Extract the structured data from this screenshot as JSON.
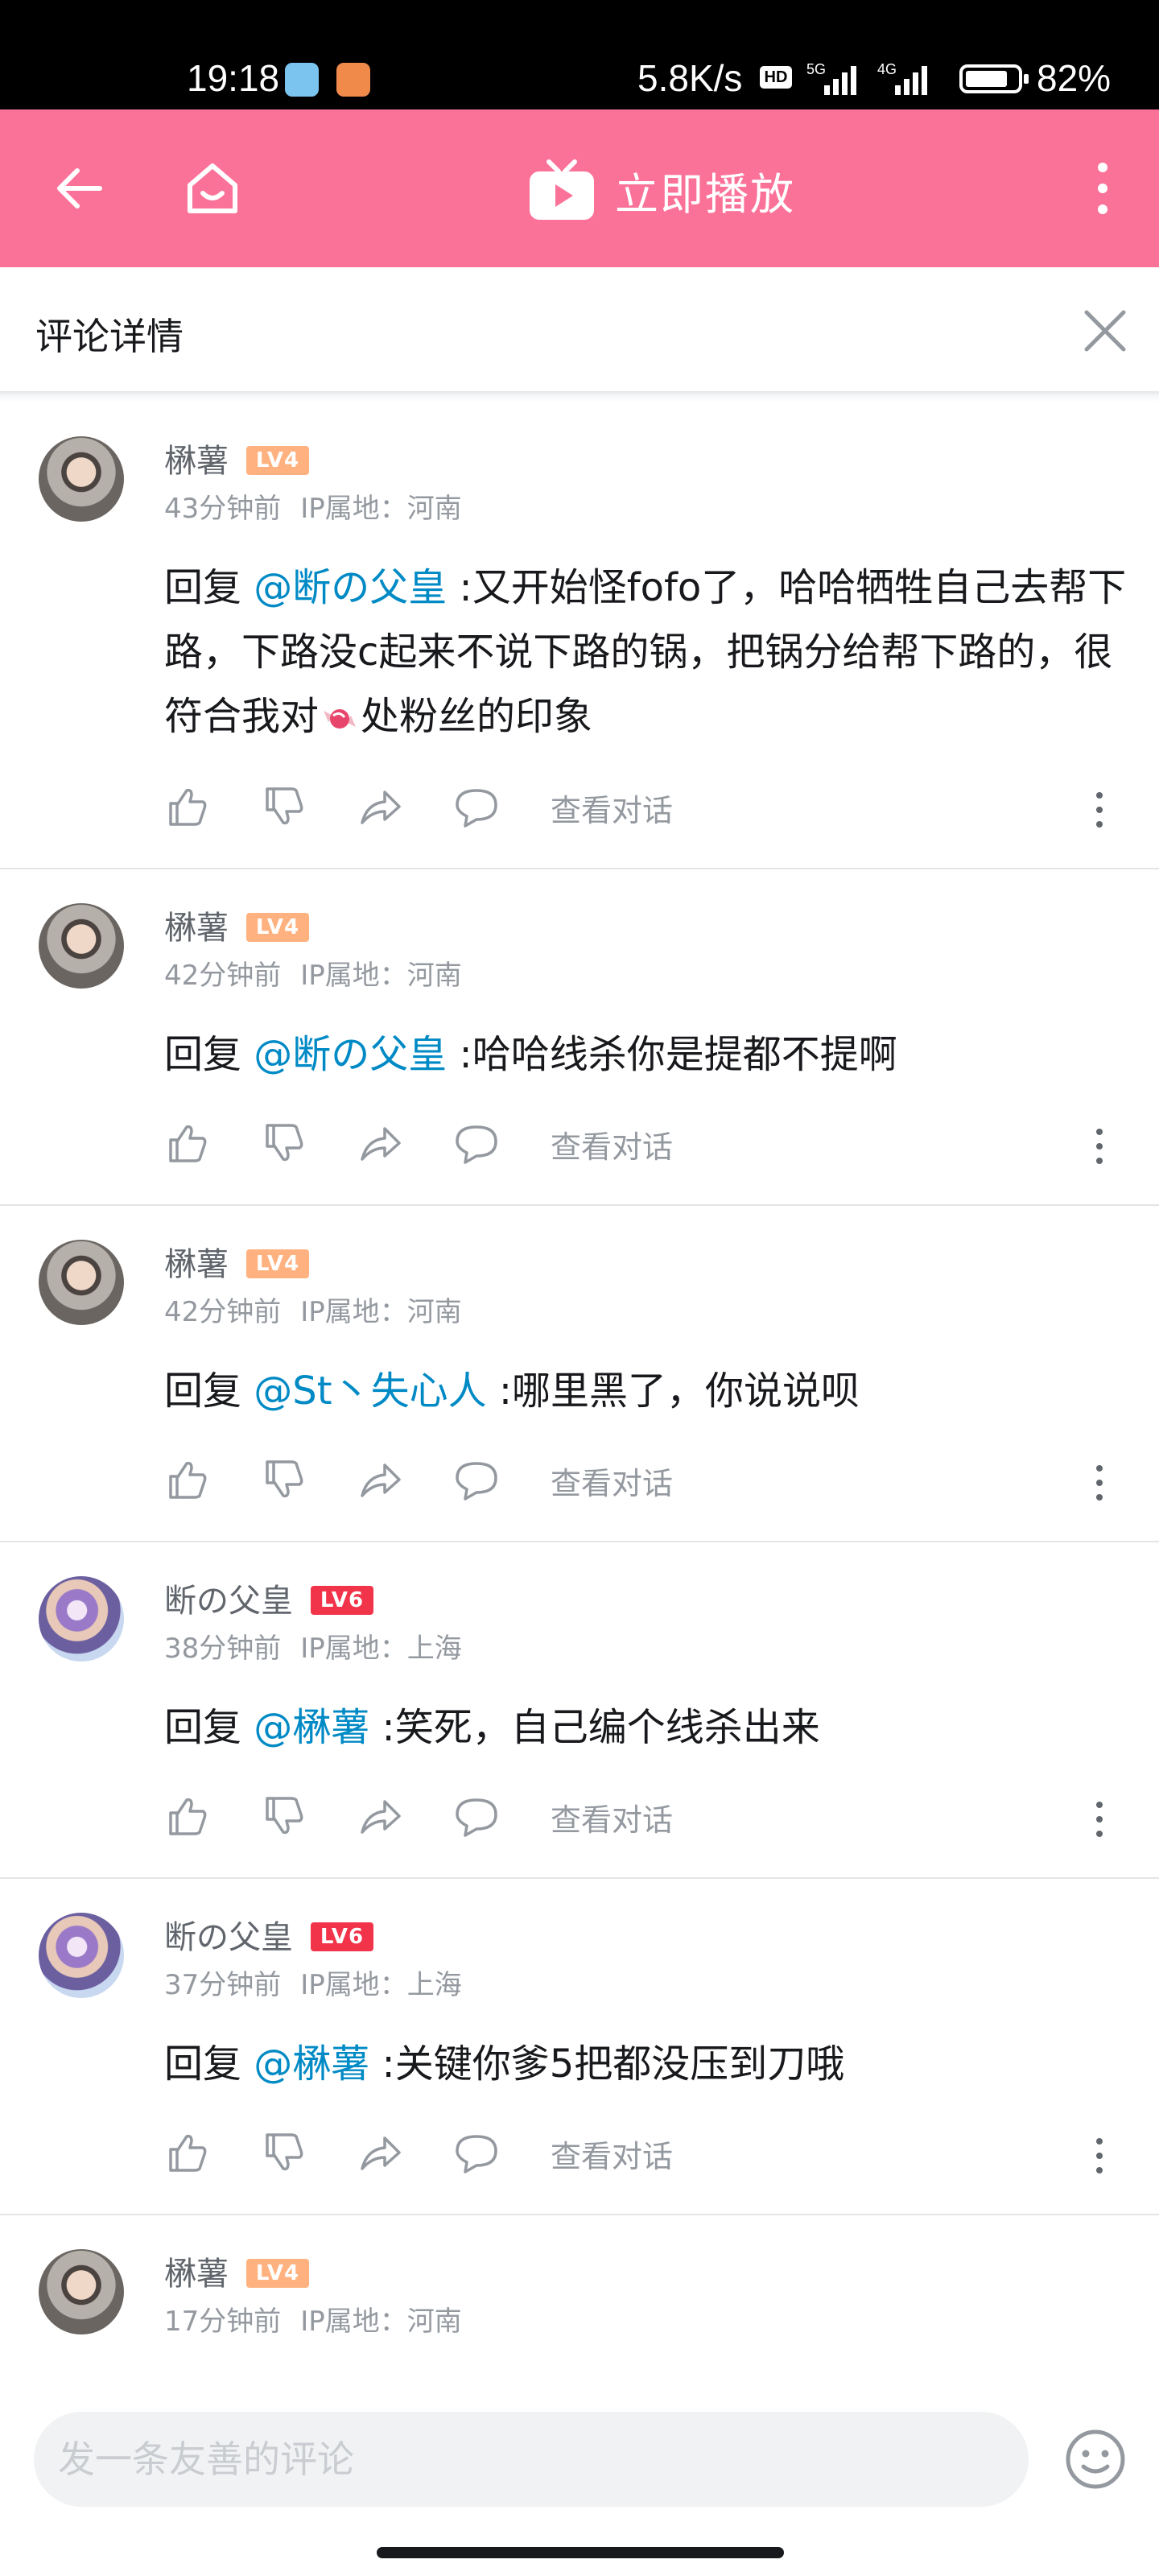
{
  "status_bar": {
    "time": "19:18",
    "net_speed": "5.8K/s",
    "hd": "HD",
    "net1": "5G",
    "net2": "4G",
    "battery": "82%",
    "battery_level": 0.82
  },
  "top_bar": {
    "play_label": "立即播放"
  },
  "detail": {
    "title": "评论详情"
  },
  "comments": [
    {
      "username": "楙薯",
      "level": "LV4",
      "time": "43分钟前",
      "ip": "IP属地：河南",
      "reply_prefix": "回复",
      "mention": "@断の父皇",
      "text_a": " :又开始怪fofo了，哈哈牺牲自己去帮下路，下路没c起来不说下路的锅，把锅分给帮下路的，很符合我对",
      "text_b": "处粉丝的印象",
      "view_label": "查看对话"
    },
    {
      "username": "楙薯",
      "level": "LV4",
      "time": "42分钟前",
      "ip": "IP属地：河南",
      "reply_prefix": "回复",
      "mention": "@断の父皇",
      "text": " :哈哈线杀你是提都不提啊",
      "view_label": "查看对话"
    },
    {
      "username": "楙薯",
      "level": "LV4",
      "time": "42分钟前",
      "ip": "IP属地：河南",
      "reply_prefix": "回复",
      "mention": "@St丶失心人",
      "text": " :哪里黑了，你说说呗",
      "view_label": "查看对话"
    },
    {
      "username": "断の父皇",
      "level": "LV6",
      "time": "38分钟前",
      "ip": "IP属地：上海",
      "reply_prefix": "回复",
      "mention": "@楙薯",
      "text": " :笑死，自己编个线杀出来",
      "view_label": "查看对话"
    },
    {
      "username": "断の父皇",
      "level": "LV6",
      "time": "37分钟前",
      "ip": "IP属地：上海",
      "reply_prefix": "回复",
      "mention": "@楙薯",
      "text": " :关键你爹5把都没压到刀哦",
      "view_label": "查看对话"
    },
    {
      "username": "楙薯",
      "level": "LV4",
      "time": "17分钟前",
      "ip": "IP属地：河南"
    }
  ],
  "bottom": {
    "input_placeholder": "发一条友善的评论"
  },
  "colors": {
    "brand_pink": "#fb7299",
    "mention_blue": "#008ac5",
    "lv4": "#ffb27f",
    "lv6": "#f2344a"
  },
  "icons": [
    "back-arrow-icon",
    "home-icon",
    "tv-play-icon",
    "more-vertical-icon",
    "close-icon",
    "like-icon",
    "dislike-icon",
    "share-icon",
    "reply-bubble-icon",
    "emoji-icon",
    "candy-emoji-icon"
  ]
}
